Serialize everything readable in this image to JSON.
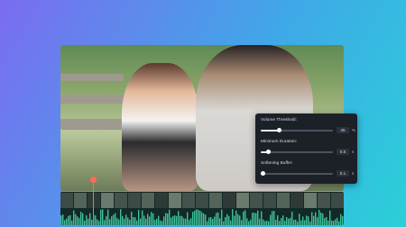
{
  "panel": {
    "rows": [
      {
        "label": "Volume Threshold:",
        "value": "25",
        "unit": "%",
        "level": 0.25
      },
      {
        "label": "Minimum Duration:",
        "value": "0.5",
        "unit": "s",
        "level": 0.1
      },
      {
        "label": "Softening Buffer:",
        "value": "0.1",
        "unit": "s",
        "level": 0.02
      }
    ]
  },
  "colors": {
    "accent": "#ff6a5c",
    "panel_bg": "#1c2128",
    "waveform": "#3dbf9a",
    "timeline_bg": "#122a26"
  },
  "timeline": {
    "playhead_icon": "playhead-marker-icon"
  }
}
